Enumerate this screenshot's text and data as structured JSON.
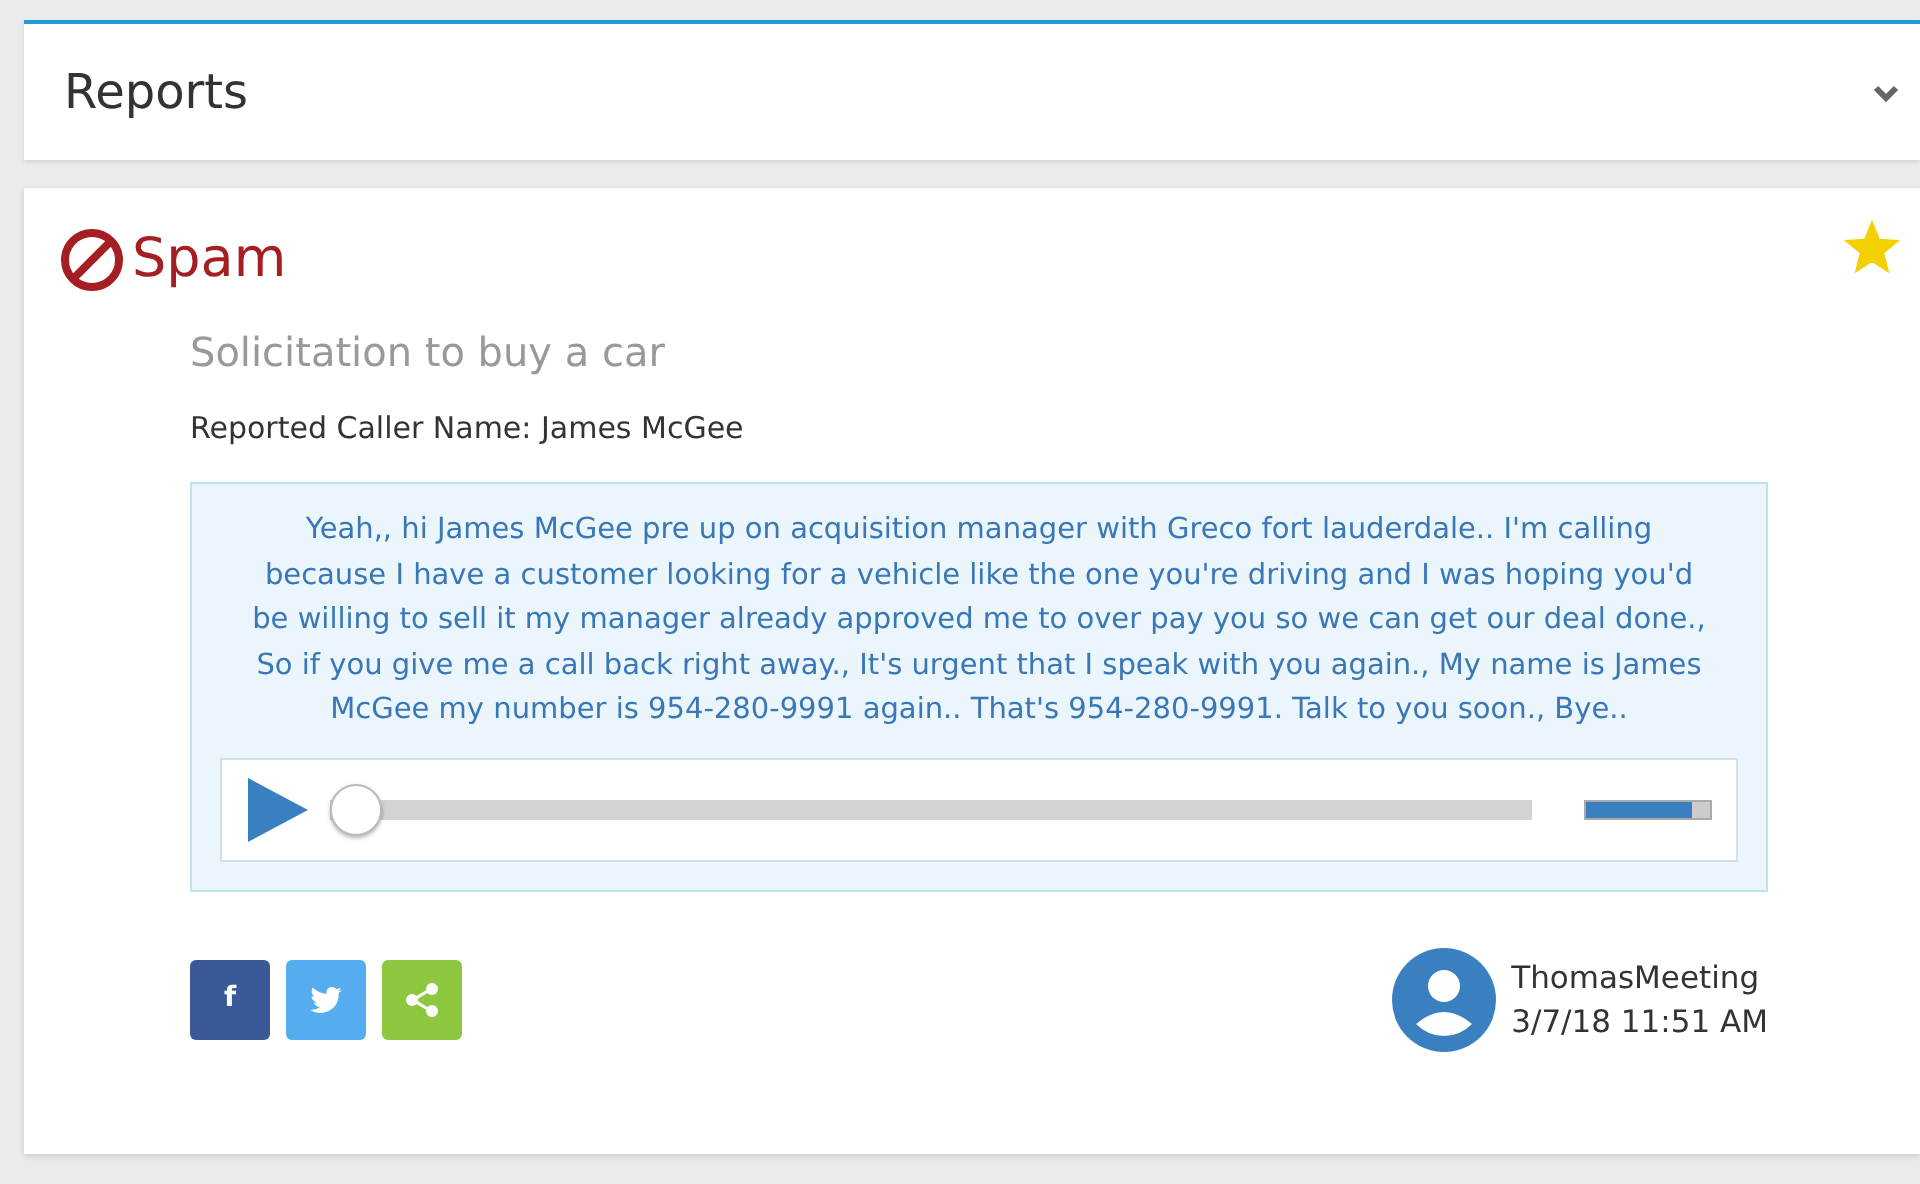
{
  "panel": {
    "title": "Reports",
    "expanded": false
  },
  "report": {
    "category": "Spam",
    "starred": true,
    "subject": "Solicitation to buy a car",
    "caller": "Reported Caller Name: James McGee",
    "transcript": "Yeah,, hi James McGee pre up on acquisition manager with Greco fort lauderdale.. I'm calling because I have a customer looking for a vehicle like the one you're driving and I was hoping you'd be willing to sell it my manager already approved me to over pay you so we can get our deal done., So if you give me a call back right away., It's urgent that I speak with you again., My name is James McGee my number is 954-280-9991 again.. That's 954-280-9991. Talk to you soon., Bye..",
    "player": {
      "playing": false,
      "seek": {
        "level": 0
      },
      "volume": {
        "level": 0.85
      }
    },
    "share": [
      {
        "kind": "facebook",
        "label": "f"
      },
      {
        "kind": "twitter"
      },
      {
        "kind": "share"
      }
    ],
    "author": {
      "name": "ThomasMeeting",
      "time": "3/7/18 11:51 AM"
    }
  }
}
